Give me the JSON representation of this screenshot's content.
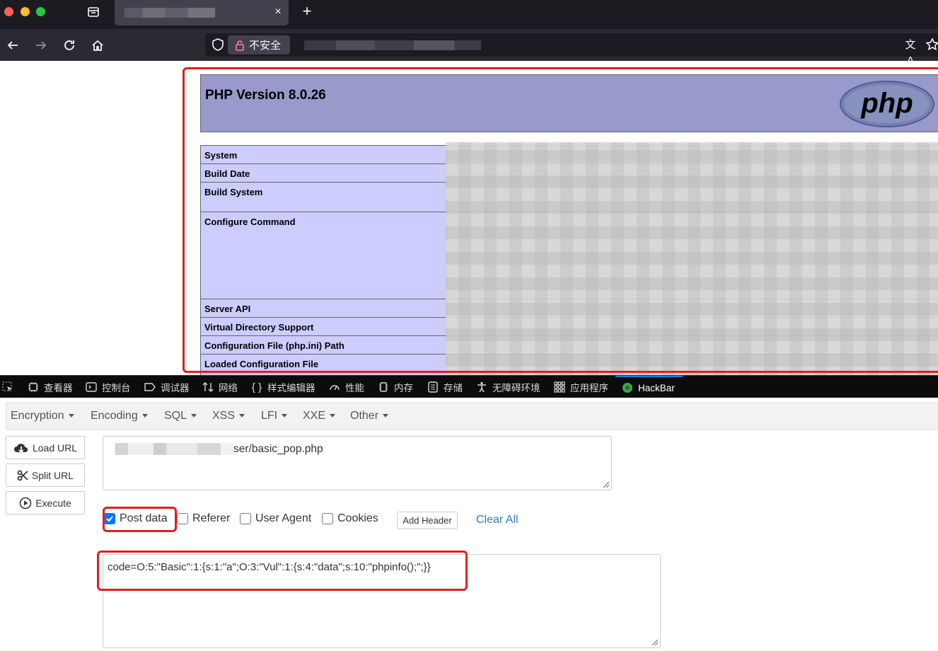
{
  "browser": {
    "window_controls": {
      "close_color": "#ff5f57",
      "minimize_color": "#febc2e",
      "zoom_color": "#28c840"
    },
    "tab": {
      "close_label": "×"
    },
    "new_tab_label": "+",
    "urlbar": {
      "security_label": "不安全",
      "translate_label": "文A"
    }
  },
  "php": {
    "title": "PHP Version 8.0.26",
    "logo_text": "php",
    "rows": [
      {
        "key": "System"
      },
      {
        "key": "Build Date"
      },
      {
        "key": "Build System"
      },
      {
        "key": "Configure Command"
      },
      {
        "key": "Server API"
      },
      {
        "key": "Virtual Directory Support"
      },
      {
        "key": "Configuration File (php.ini) Path"
      },
      {
        "key": "Loaded Configuration File"
      }
    ]
  },
  "devtools": {
    "tabs": [
      {
        "label": "查看器",
        "icon": "inspector-icon"
      },
      {
        "label": "控制台",
        "icon": "console-icon"
      },
      {
        "label": "调试器",
        "icon": "debugger-icon"
      },
      {
        "label": "网络",
        "icon": "network-icon"
      },
      {
        "label": "样式编辑器",
        "icon": "style-editor-icon"
      },
      {
        "label": "性能",
        "icon": "performance-icon"
      },
      {
        "label": "内存",
        "icon": "memory-icon"
      },
      {
        "label": "存储",
        "icon": "storage-icon"
      },
      {
        "label": "无障碍环境",
        "icon": "accessibility-icon"
      },
      {
        "label": "应用程序",
        "icon": "application-icon"
      },
      {
        "label": "HackBar",
        "icon": "hackbar-icon"
      }
    ],
    "active_tab": "HackBar"
  },
  "hackbar": {
    "menus": [
      "Encryption",
      "Encoding",
      "SQL",
      "XSS",
      "LFI",
      "XXE",
      "Other"
    ],
    "buttons": {
      "load_url": "Load URL",
      "split_url": "Split URL",
      "execute": "Execute"
    },
    "url_suffix": "ser/basic_pop.php",
    "options": {
      "post_data": {
        "label": "Post data",
        "checked": true
      },
      "referer": {
        "label": "Referer",
        "checked": false
      },
      "user_agent": {
        "label": "User Agent",
        "checked": false
      },
      "cookies": {
        "label": "Cookies",
        "checked": false
      }
    },
    "add_header": "Add Header",
    "clear_all": "Clear All",
    "post_body": "code=O:5:\"Basic\":1:{s:1:\"a\";O:3:\"Vul\":1:{s:4:\"data\";s:10:\"phpinfo();\";}}"
  }
}
